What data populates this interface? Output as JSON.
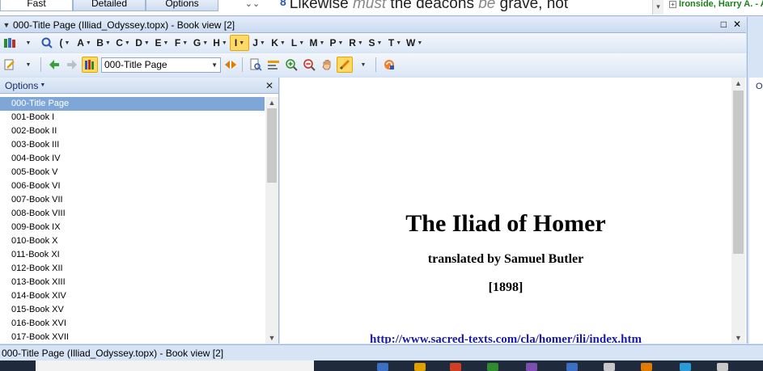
{
  "top_strip": {
    "mode_tabs": [
      {
        "label": "Fast",
        "active": true
      },
      {
        "label": "Detailed",
        "active": false
      },
      {
        "label": "Options",
        "active": false
      }
    ],
    "verse_number": "8",
    "verse_text_parts": [
      "Likewise ",
      "must",
      " the deacons ",
      "be",
      " grave, not"
    ],
    "xref_text": "Ironside, Harry A. - A"
  },
  "window": {
    "title": "000-Title Page (Illiad_Odyssey.topx) - Book view [2]"
  },
  "letter_toolbar": {
    "first_letter": "(",
    "letters": [
      "A",
      "B",
      "C",
      "D",
      "E",
      "F",
      "G",
      "H",
      "I",
      "J",
      "K",
      "L",
      "M",
      "P",
      "R",
      "S",
      "T",
      "W"
    ],
    "active_letter": "I"
  },
  "nav_toolbar": {
    "current_book": "000-Title Page"
  },
  "left_panel": {
    "header": "Options",
    "books": [
      "000-Title Page",
      "001-Book I",
      "002-Book II",
      "003-Book III",
      "004-Book IV",
      "005-Book V",
      "006-Book VI",
      "007-Book VII",
      "008-Book VIII",
      "009-Book IX",
      "010-Book X",
      "011-Book XI",
      "012-Book XII",
      "013-Book XIII",
      "014-Book XIV",
      "015-Book XV",
      "016-Book XVI",
      "017-Book XVII"
    ],
    "selected_index": 0
  },
  "document": {
    "title": "The Iliad of Homer",
    "subtitle": "translated by Samuel Butler",
    "year": "[1898]",
    "link": "http://www.sacred-texts.com/cla/homer/ili/index.htm"
  },
  "right_panel": {
    "label": "O"
  },
  "status_bar": {
    "text": "000-Title Page (Illiad_Odyssey.topx) - Book view [2]"
  },
  "colors": {
    "accent_active": "#ffd966",
    "selection": "#7ea7d8",
    "link": "#1a1aa8",
    "xref_green": "#1a7f1a"
  }
}
